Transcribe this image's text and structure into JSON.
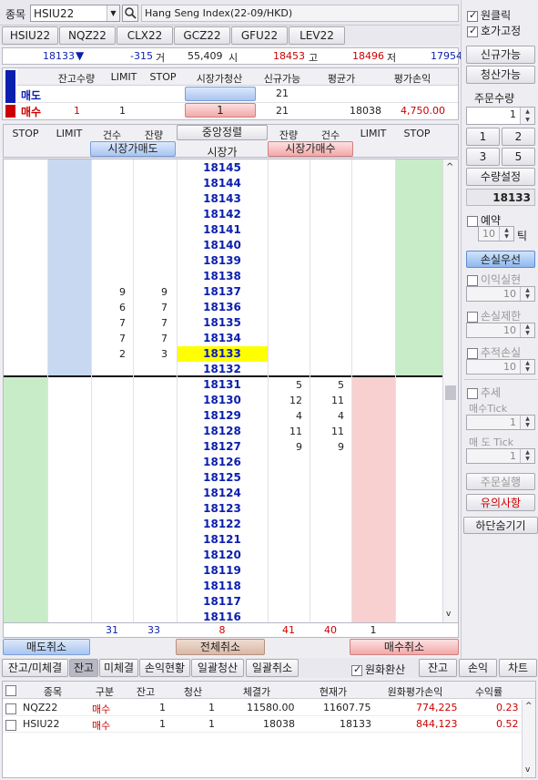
{
  "header": {
    "label": "종목",
    "symbol": "HSIU22",
    "name": "Hang Seng Index(22-09/HKD)"
  },
  "symbol_tabs": [
    "HSIU22",
    "NQZ22",
    "CLX22",
    "GCZ22",
    "GFU22",
    "LEV22"
  ],
  "quote": {
    "last": "18133",
    "arrow": "▼",
    "change": "-315",
    "vol_label": "거",
    "volume": "55,409",
    "open_label": "시",
    "open": "18453",
    "high_label": "고",
    "high": "18496",
    "low_label": "저",
    "low": "17954"
  },
  "position": {
    "headers": [
      "잔고수량",
      "LIMIT",
      "STOP",
      "시장가청산",
      "신규가능",
      "평균가",
      "평가손익"
    ],
    "sell": {
      "label": "매도",
      "qty": "",
      "limit": "",
      "stop": "",
      "close": "",
      "new": "21",
      "avg": "",
      "pnl": ""
    },
    "buy": {
      "label": "매수",
      "qty": "1",
      "limit": "1",
      "stop": "",
      "close": "1",
      "new": "21",
      "avg": "18038",
      "pnl": "4,750.00"
    }
  },
  "ladder_headers": [
    "STOP",
    "LIMIT",
    "건수",
    "잔량",
    "중앙정렬",
    "잔량",
    "건수",
    "LIMIT",
    "STOP"
  ],
  "market_sell": "시장가매도",
  "market_label": "시장가",
  "market_buy": "시장가매수",
  "ladder": [
    {
      "price": "18145",
      "ac": "",
      "aq": "",
      "bq": "",
      "bc": ""
    },
    {
      "price": "18144",
      "ac": "",
      "aq": "",
      "bq": "",
      "bc": ""
    },
    {
      "price": "18143",
      "ac": "",
      "aq": "",
      "bq": "",
      "bc": ""
    },
    {
      "price": "18142",
      "ac": "",
      "aq": "",
      "bq": "",
      "bc": ""
    },
    {
      "price": "18141",
      "ac": "",
      "aq": "",
      "bq": "",
      "bc": ""
    },
    {
      "price": "18140",
      "ac": "",
      "aq": "",
      "bq": "",
      "bc": ""
    },
    {
      "price": "18139",
      "ac": "",
      "aq": "",
      "bq": "",
      "bc": ""
    },
    {
      "price": "18138",
      "ac": "",
      "aq": "",
      "bq": "",
      "bc": ""
    },
    {
      "price": "18137",
      "ac": "9",
      "aq": "9",
      "bq": "",
      "bc": ""
    },
    {
      "price": "18136",
      "ac": "6",
      "aq": "7",
      "bq": "",
      "bc": ""
    },
    {
      "price": "18135",
      "ac": "7",
      "aq": "7",
      "bq": "",
      "bc": ""
    },
    {
      "price": "18134",
      "ac": "7",
      "aq": "7",
      "bq": "",
      "bc": ""
    },
    {
      "price": "18133",
      "ac": "2",
      "aq": "3",
      "bq": "",
      "bc": "",
      "current": true
    },
    {
      "price": "18132",
      "ac": "",
      "aq": "",
      "bq": "",
      "bc": ""
    },
    {
      "price": "18131",
      "ac": "",
      "aq": "",
      "bq": "5",
      "bc": "5"
    },
    {
      "price": "18130",
      "ac": "",
      "aq": "",
      "bq": "12",
      "bc": "11"
    },
    {
      "price": "18129",
      "ac": "",
      "aq": "",
      "bq": "4",
      "bc": "4"
    },
    {
      "price": "18128",
      "ac": "",
      "aq": "",
      "bq": "11",
      "bc": "11"
    },
    {
      "price": "18127",
      "ac": "",
      "aq": "",
      "bq": "9",
      "bc": "9"
    },
    {
      "price": "18126",
      "ac": "",
      "aq": "",
      "bq": "",
      "bc": ""
    },
    {
      "price": "18125",
      "ac": "",
      "aq": "",
      "bq": "",
      "bc": ""
    },
    {
      "price": "18124",
      "ac": "",
      "aq": "",
      "bq": "",
      "bc": ""
    },
    {
      "price": "18123",
      "ac": "",
      "aq": "",
      "bq": "",
      "bc": ""
    },
    {
      "price": "18122",
      "ac": "",
      "aq": "",
      "bq": "",
      "bc": ""
    },
    {
      "price": "18121",
      "ac": "",
      "aq": "",
      "bq": "",
      "bc": ""
    },
    {
      "price": "18120",
      "ac": "",
      "aq": "",
      "bq": "",
      "bc": ""
    },
    {
      "price": "18119",
      "ac": "",
      "aq": "",
      "bq": "",
      "bc": ""
    },
    {
      "price": "18118",
      "ac": "",
      "aq": "",
      "bq": "",
      "bc": ""
    },
    {
      "price": "18117",
      "ac": "",
      "aq": "",
      "bq": "",
      "bc": ""
    },
    {
      "price": "18116",
      "ac": "",
      "aq": "",
      "bq": "",
      "bc": ""
    }
  ],
  "totals": {
    "ask_count": "31",
    "ask_qty": "33",
    "diff": "8",
    "bid_qty": "41",
    "bid_count": "40",
    "bid_limit": "1"
  },
  "cancel_sell": "매도취소",
  "cancel_all": "전체취소",
  "cancel_buy": "매수취소",
  "bottom_tabs": [
    "잔고/미체결",
    "잔고",
    "미체결",
    "손익현황",
    "일괄청산",
    "일괄취소"
  ],
  "krw_convert": "원화환산",
  "bottom_buttons": [
    "잔고",
    "손익",
    "차트"
  ],
  "balance_headers": [
    "종목",
    "구분",
    "잔고",
    "청산",
    "체결가",
    "현재가",
    "원화평가손익",
    "수익률"
  ],
  "balance_rows": [
    {
      "symbol": "NQZ22",
      "side": "매수",
      "qty": "1",
      "close": "1",
      "fill": "11580.00",
      "cur": "11607.75",
      "pnl": "774,225",
      "ret": "0.23"
    },
    {
      "symbol": "HSIU22",
      "side": "매수",
      "qty": "1",
      "close": "1",
      "fill": "18038",
      "cur": "18133",
      "pnl": "844,123",
      "ret": "0.52"
    }
  ],
  "side_panel": {
    "one_click": "원클릭",
    "fix_quote": "호가고정",
    "new_avail": "신규가능",
    "close_avail": "청산가능",
    "order_qty_label": "주문수량",
    "order_qty": "1",
    "qty_buttons": [
      "1",
      "2",
      "3",
      "5"
    ],
    "qty_setting": "수량설정",
    "price_display": "18133",
    "reserve": "예약",
    "reserve_val": "10",
    "tick": "틱",
    "loss_first": "손실우선",
    "profit_real": "이익실현",
    "profit_val": "10",
    "loss_limit": "손실제한",
    "loss_val": "10",
    "trail_loss": "추적손실",
    "trail_val": "10",
    "trend": "추세",
    "buy_tick": "매수Tick",
    "buy_tick_val": "1",
    "sell_tick": "매 도 Tick",
    "sell_tick_val": "1",
    "order_exec": "주문실행",
    "notice": "유의사항",
    "hide_bottom": "하단숨기기"
  }
}
